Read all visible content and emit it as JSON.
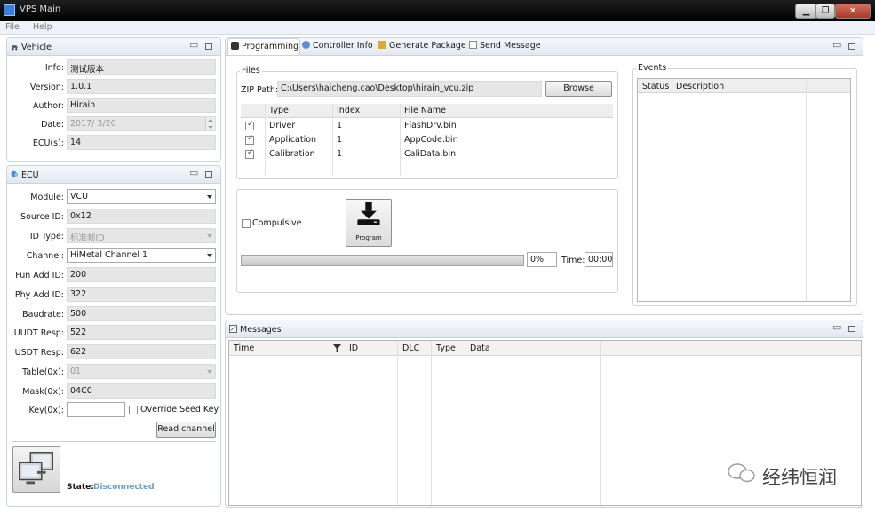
{
  "window": {
    "title": "VPS Main",
    "minimize": "▁",
    "restore": "❐",
    "close": "✕"
  },
  "menu": [
    "File",
    "Help"
  ],
  "vehicle": {
    "title": "Vehicle",
    "fields": [
      {
        "label": "Info:",
        "value": "测试版本"
      },
      {
        "label": "Version:",
        "value": "1.0.1"
      },
      {
        "label": "Author:",
        "value": "Hirain"
      },
      {
        "label": "Date:",
        "value": "2017/ 3/20"
      },
      {
        "label": "ECU(s):",
        "value": "14"
      }
    ]
  },
  "ecu": {
    "title": "ECU",
    "fields": [
      {
        "label": "Module:",
        "value": "VCU"
      },
      {
        "label": "Source ID:",
        "value": "0x12"
      },
      {
        "label": "ID Type:",
        "value": "标准帧ID"
      },
      {
        "label": "Channel:",
        "value": "HiMetal Channel 1"
      },
      {
        "label": "Fun Add ID:",
        "value": "200"
      },
      {
        "label": "Phy Add ID:",
        "value": "322"
      },
      {
        "label": "Baudrate:",
        "value": "500"
      },
      {
        "label": "UUDT Resp:",
        "value": "522"
      },
      {
        "label": "USDT Resp:",
        "value": "622"
      },
      {
        "label": "Table(0x):",
        "value": "01"
      },
      {
        "label": "Mask(0x):",
        "value": "04C0"
      },
      {
        "label": "Key(0x):",
        "value": ""
      }
    ],
    "override_label": "Override Seed Key",
    "read_channel": "Read channel",
    "state_label": "State:",
    "state_value": "Disconnected",
    "state_color": "#6fa0c9"
  },
  "tabs": [
    {
      "label": "Programming",
      "icon": "chip-icon"
    },
    {
      "label": "Controller Info",
      "icon": "info-icon"
    },
    {
      "label": "Generate Package",
      "icon": "package-icon"
    },
    {
      "label": "Send Message",
      "icon": "message-icon"
    }
  ],
  "files": {
    "group_label": "Files",
    "zip_label": "ZIP Path:",
    "zip_value": "C:\\Users\\haicheng.cao\\Desktop\\hirain_vcu.zip",
    "browse": "Browse",
    "columns": [
      "Type",
      "Index",
      "File Name"
    ],
    "rows": [
      {
        "type": "Driver",
        "index": "1",
        "file": "FlashDrv.bin"
      },
      {
        "type": "Application",
        "index": "1",
        "file": "AppCode.bin"
      },
      {
        "type": "Calibration",
        "index": "1",
        "file": "CaliData.bin"
      }
    ]
  },
  "program": {
    "compulsive": "Compulsive",
    "button": "Program",
    "percent": "0%",
    "progress": 0,
    "time_label": "Time:",
    "time_value": "00:00"
  },
  "events": {
    "group_label": "Events",
    "columns": [
      "Status",
      "Description"
    ]
  },
  "messages": {
    "title": "Messages",
    "columns": [
      "Time",
      "ID",
      "DLC",
      "Type",
      "Data"
    ]
  },
  "watermark": "经纬恒润"
}
